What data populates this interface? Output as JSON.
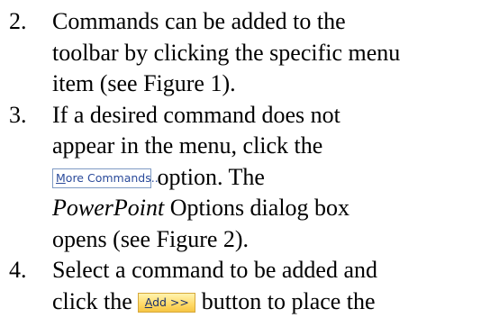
{
  "steps": [
    {
      "number": "2.",
      "lines": [
        "Commands can be added to the",
        "toolbar by clicking the specific menu",
        "item (see Figure 1)."
      ]
    },
    {
      "number": "3.",
      "line1": "If a desired command does not",
      "line2": "appear in the menu, click the",
      "button": {
        "accel": "M",
        "rest": "ore Commands..."
      },
      "line3_after": " option. The",
      "line4_italic": "PowerPoint",
      "line4_after": " Options dialog box",
      "line5": "opens (see Figure 2)."
    },
    {
      "number": "4.",
      "line1": "Select a command to be added and",
      "line2_before": "click the ",
      "button": {
        "accel": "A",
        "rest": "dd >>"
      },
      "line2_after": " button to place the"
    }
  ],
  "colors": {
    "text": "#000000",
    "more_button_text": "#2a4a9a",
    "add_button_fill": "#ffd966"
  }
}
